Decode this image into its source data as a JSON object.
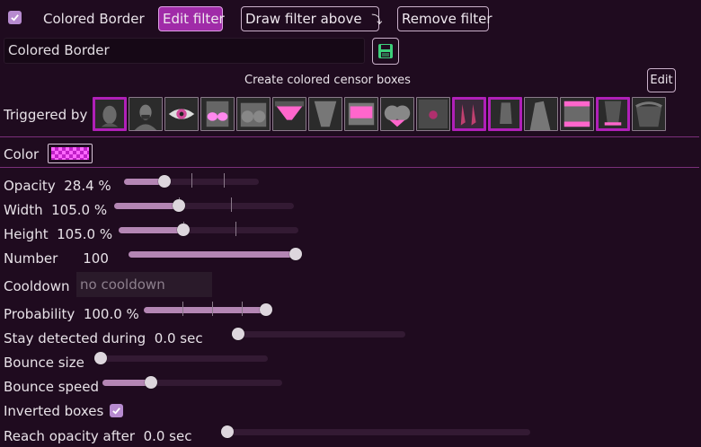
{
  "header": {
    "enabled": true,
    "filter_name": "Colored Border",
    "edit_filter": "Edit filter",
    "draw_filter_above": "Draw filter above",
    "draw_arrow": "⤵",
    "remove_filter": "Remove filter"
  },
  "name_field": {
    "value": "Colored Border"
  },
  "description": "Create colored censor boxes",
  "edit_label": "Edit",
  "triggered": {
    "label": "Triggered by",
    "items": [
      {
        "name": "face-female",
        "selected": true
      },
      {
        "name": "face-male",
        "selected": false
      },
      {
        "name": "eye",
        "selected": false
      },
      {
        "name": "breasts-covered",
        "selected": false
      },
      {
        "name": "breasts-exposed",
        "selected": false
      },
      {
        "name": "genitalia-covered",
        "selected": false
      },
      {
        "name": "genitalia-exposed",
        "selected": false
      },
      {
        "name": "buttocks-covered",
        "selected": false
      },
      {
        "name": "buttocks-exposed",
        "selected": false
      },
      {
        "name": "anus",
        "selected": false
      },
      {
        "name": "feet-covered",
        "selected": true
      },
      {
        "name": "feet-exposed",
        "selected": true
      },
      {
        "name": "armpits",
        "selected": false
      },
      {
        "name": "belly-covered",
        "selected": false
      },
      {
        "name": "belly-exposed",
        "selected": true
      },
      {
        "name": "male-chest",
        "selected": false
      }
    ]
  },
  "color": {
    "label": "Color",
    "value": "#ff66ff"
  },
  "sliders": {
    "opacity": {
      "label": "Opacity",
      "value": "28.4 %",
      "fraction": 0.3
    },
    "width": {
      "label": "Width",
      "value": "105.0 %",
      "fraction": 0.36
    },
    "height": {
      "label": "Height",
      "value": "105.0 %",
      "fraction": 0.36
    },
    "number": {
      "label": "Number",
      "value": "100",
      "fraction": 1.0
    },
    "probability": {
      "label": "Probability",
      "value": "100.0 %",
      "fraction": 1.0
    },
    "stay": {
      "label": "Stay detected during",
      "value": "0.0 sec",
      "fraction": 0.0
    },
    "bounce_size": {
      "label": "Bounce size",
      "fraction": 0.0
    },
    "bounce_speed": {
      "label": "Bounce speed",
      "fraction": 0.27
    },
    "reach": {
      "label": "Reach opacity after",
      "value": "0.0 sec",
      "fraction": 0.0
    }
  },
  "cooldown": {
    "label": "Cooldown",
    "placeholder": "no cooldown"
  },
  "inverted": {
    "label": "Inverted boxes",
    "checked": true
  },
  "colors": {
    "accent": "#a02ba8",
    "track": "#331a33",
    "fill": "#b486b4",
    "bg": "#1f0b1f"
  }
}
